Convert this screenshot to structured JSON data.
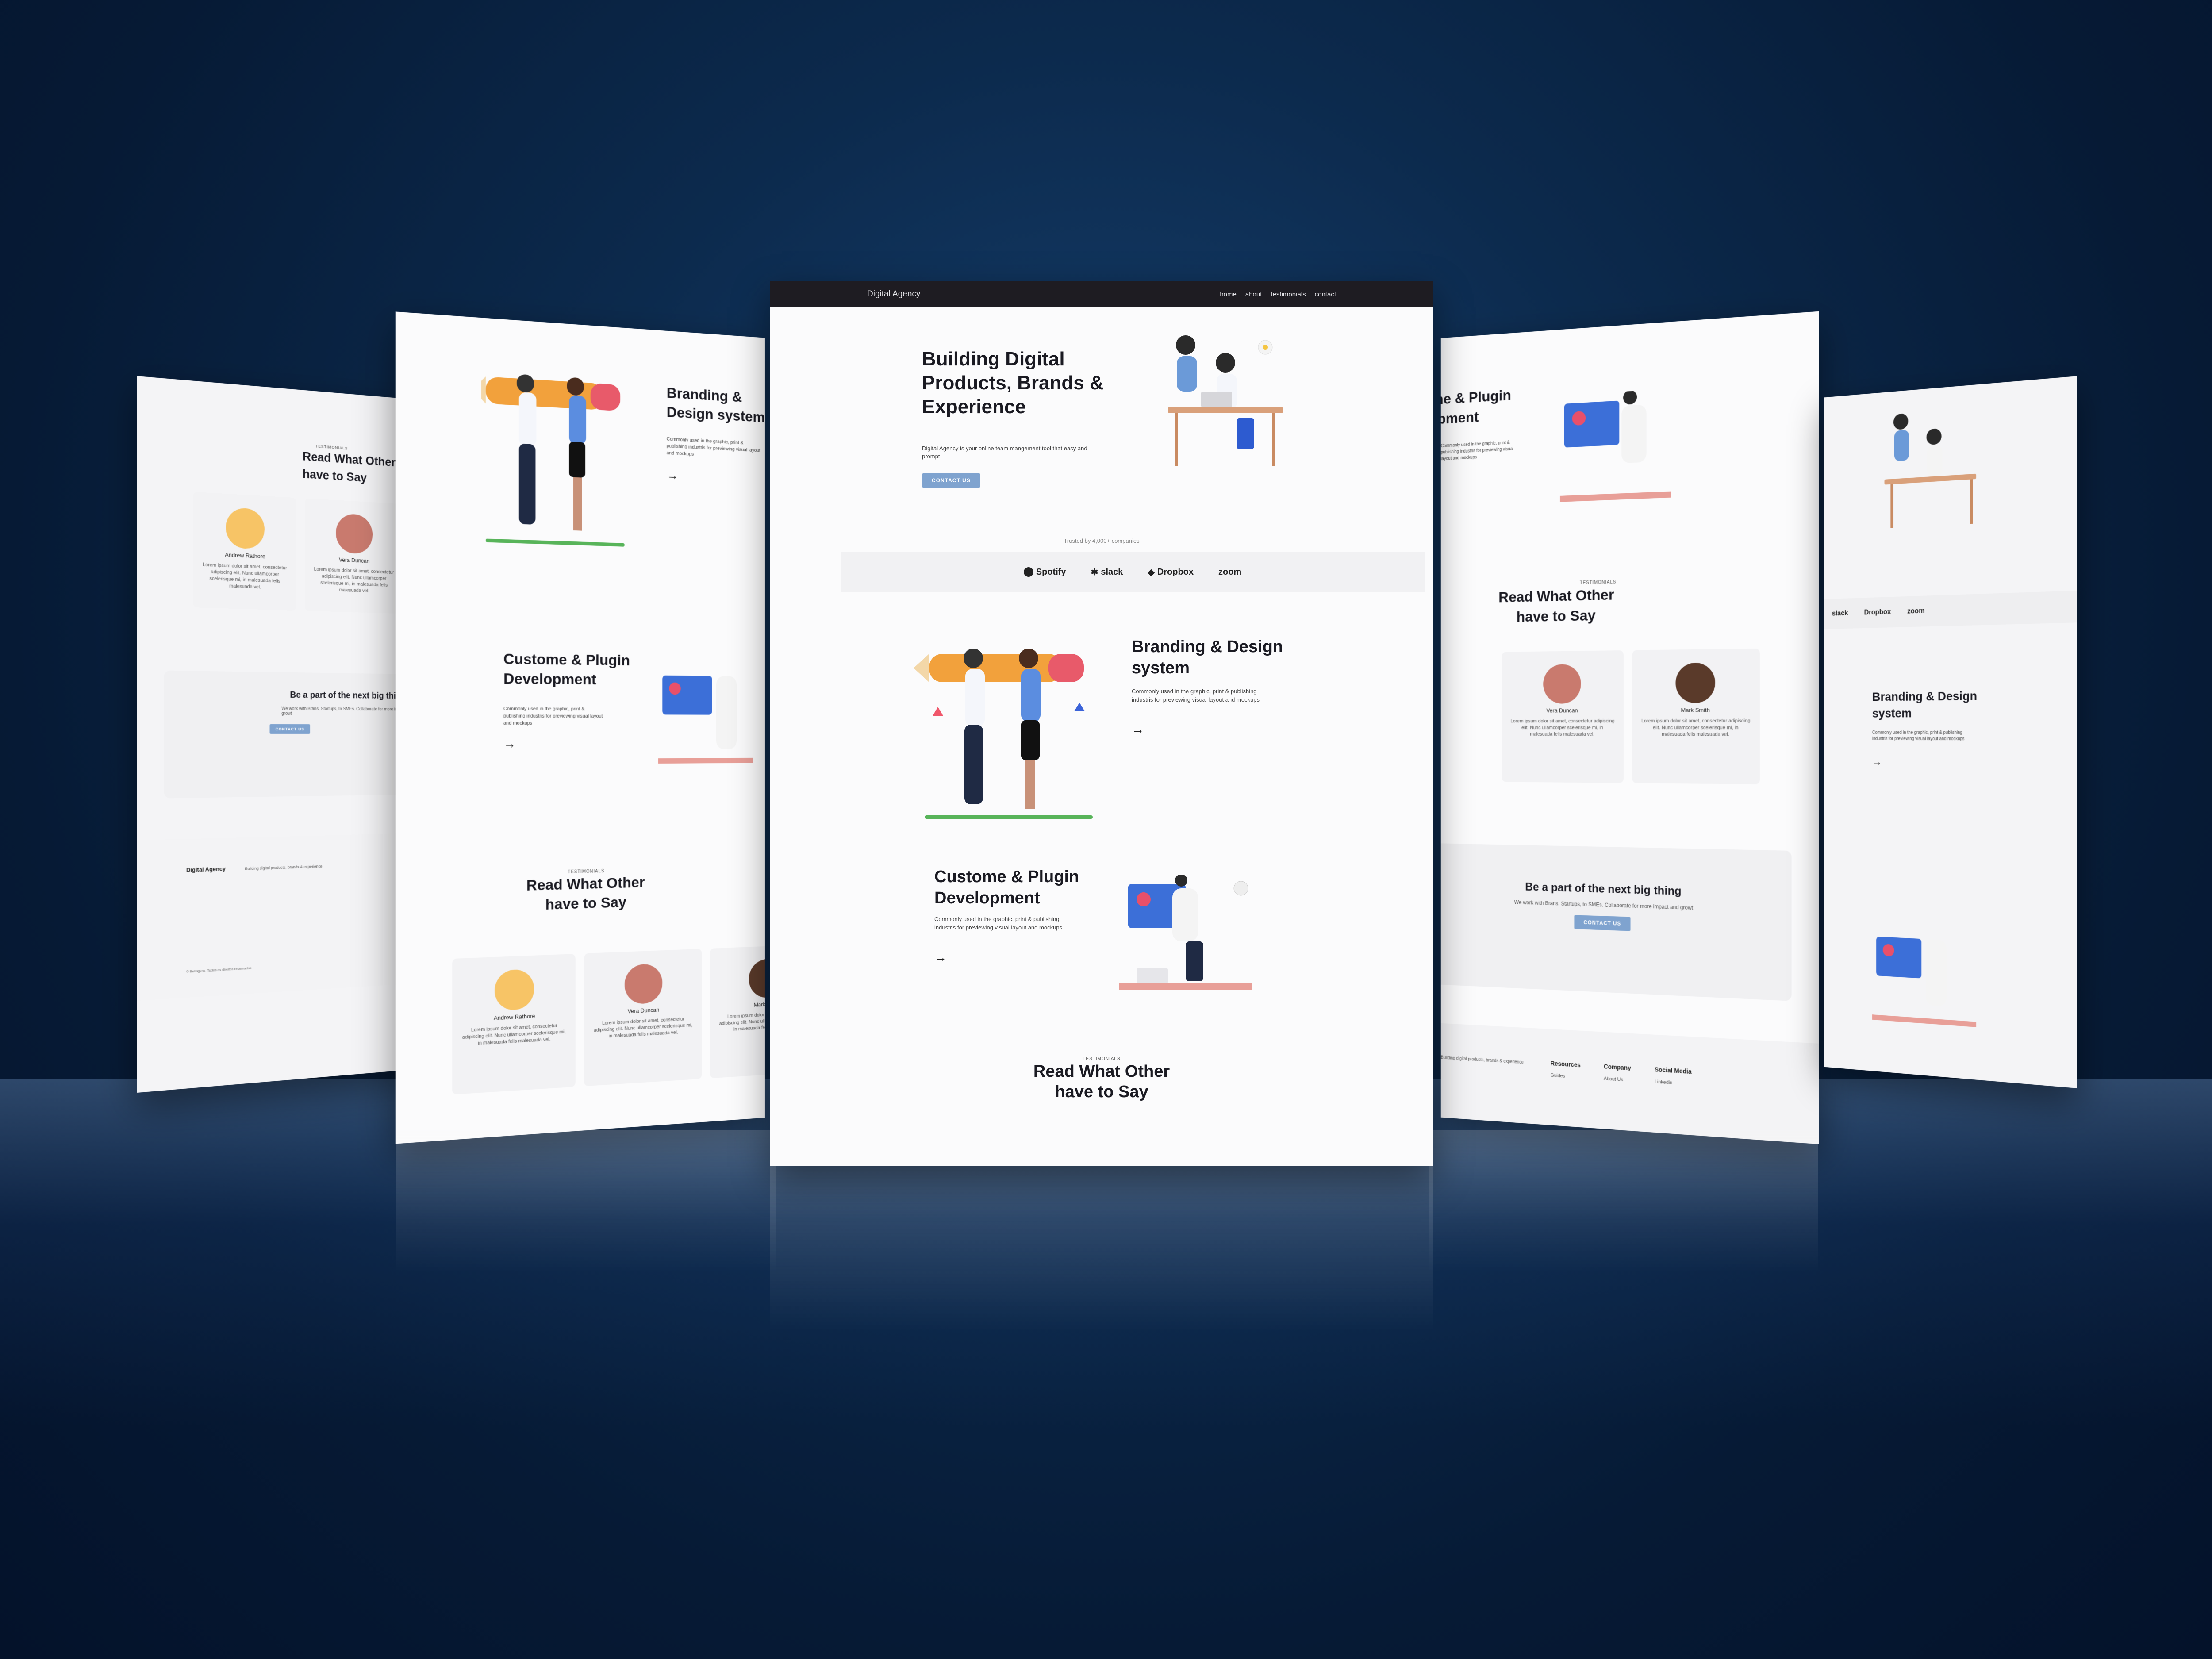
{
  "nav": {
    "brand": "Digital Agency",
    "links": [
      "home",
      "about",
      "testimonials",
      "contact"
    ]
  },
  "hero": {
    "title": "Building Digital Products, Brands & Experience",
    "subtitle": "Digital Agency is your online team mangement tool that easy and prompt",
    "cta": "CONTACT US"
  },
  "trusted": {
    "label": "Trusted by 4,000+ companies",
    "logos": [
      "Spotify",
      "slack",
      "Dropbox",
      "zoom"
    ]
  },
  "branding": {
    "title": "Branding & Design system",
    "text": "Commonly used in the graphic, print & publishing industris for previewing visual layout and mockups"
  },
  "plugin": {
    "title": "Custome & Plugin Development",
    "text": "Commonly used in the graphic, print & publishing industris for previewing visual layout and mockups"
  },
  "testimonials": {
    "label": "TESTIMONIALS",
    "title": "Read What Other have to Say",
    "items": [
      {
        "name": "Andrew Rathore",
        "text": "Lorem ipsum dolor sit amet, consectetur adipiscing elit. Nunc ullamcorper scelerisque mi, in malesuada felis malesuada vel."
      },
      {
        "name": "Vera Duncan",
        "text": "Lorem ipsum dolor sit amet, consectetur adipiscing elit. Nunc ullamcorper scelerisque mi, in malesuada felis malesuada vel."
      },
      {
        "name": "Mark Smith",
        "text": "Lorem ipsum dolor sit amet, consectetur adipiscing elit. Nunc ullamcorper scelerisque mi, in malesuada felis malesuada vel."
      }
    ]
  },
  "cta": {
    "title": "Be a part of the next big thing",
    "text": "We work with Brans, Startups, to SMEs. Collaborate for more impact and growt",
    "button": "CONTACT US"
  },
  "footer": {
    "brand": "Digital Agency",
    "tagline": "Building digital products, brands & experience",
    "columns": [
      {
        "title": "Resources",
        "items": [
          "Guides"
        ]
      },
      {
        "title": "Company",
        "items": [
          "About Us"
        ]
      },
      {
        "title": "Social Media",
        "items": [
          "Linkedin"
        ]
      }
    ],
    "copyright": "© Betingkos. Todos os direitos reservados"
  },
  "colors": {
    "accent": "#7fa3cf",
    "nav_bg": "#1e1c22",
    "backdrop": "#0c2a4d"
  }
}
